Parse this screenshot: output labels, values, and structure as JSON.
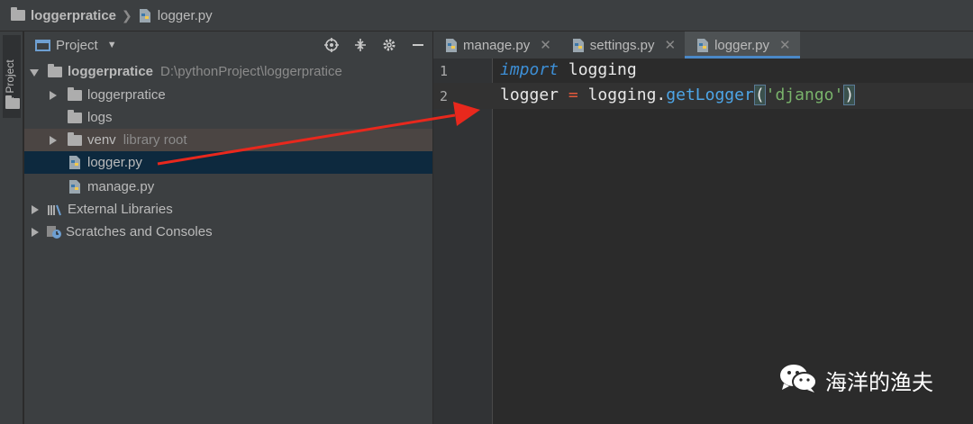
{
  "navbar": {
    "project": "loggerpratice",
    "file": "logger.py"
  },
  "toolstrip": {
    "label": "1: Project"
  },
  "project_panel": {
    "title": "Project",
    "tree": [
      {
        "label": "loggerpratice",
        "extra": "D:\\pythonProject\\loggerpratice",
        "type": "folder",
        "expanded": true
      },
      {
        "label": "loggerpratice",
        "type": "folder",
        "expanded": false
      },
      {
        "label": "logs",
        "type": "folder"
      },
      {
        "label": "venv",
        "extra": "library root",
        "type": "folder",
        "expanded": false
      },
      {
        "label": "logger.py",
        "type": "python-file",
        "selected": true
      },
      {
        "label": "manage.py",
        "type": "python-file"
      },
      {
        "label": "External Libraries",
        "type": "libraries",
        "expanded": false
      },
      {
        "label": "Scratches and Consoles",
        "type": "scratches",
        "expanded": false
      }
    ]
  },
  "tabs": [
    {
      "label": "manage.py",
      "active": false
    },
    {
      "label": "settings.py",
      "active": false
    },
    {
      "label": "logger.py",
      "active": true
    }
  ],
  "editor": {
    "line_numbers": [
      "1",
      "2"
    ],
    "line1": {
      "keyword": "import",
      "module": "logging"
    },
    "line2": {
      "var": "logger",
      "op": "=",
      "obj": "logging",
      "dot": ".",
      "func": "getLogger",
      "open": "(",
      "arg": "'django'",
      "close": ")"
    }
  },
  "watermark": {
    "text": "海洋的渔夫",
    "icon": "wechat-icon"
  },
  "colors": {
    "accent": "#4a88c7",
    "arrow": "#e8281d",
    "selection": "#0d293e"
  }
}
